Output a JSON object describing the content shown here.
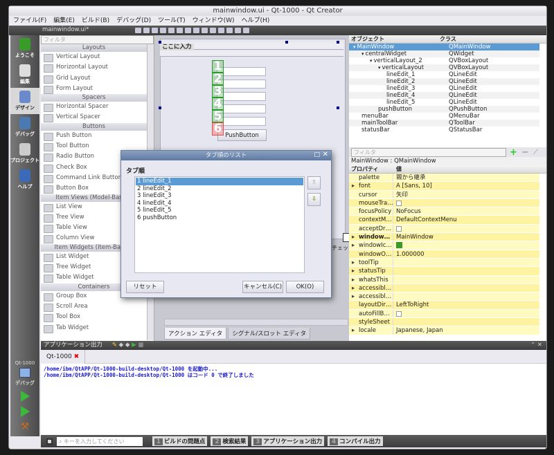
{
  "window": {
    "title": "mainwindow.ui - Qt-1000 - Qt Creator"
  },
  "menu": [
    "ファイル(F)",
    "編集(E)",
    "ビルド(B)",
    "デバッグ(D)",
    "ツール(T)",
    "ウィンドウ(W)",
    "ヘルプ(H)"
  ],
  "toolbar": {
    "file_combo": "mainwindow.ui*"
  },
  "modes": [
    {
      "label": "ようこそ"
    },
    {
      "label": "編集"
    },
    {
      "label": "デザイン",
      "selected": true
    },
    {
      "label": "デバッグ"
    },
    {
      "label": "プロジェクト"
    },
    {
      "label": "ヘルプ"
    }
  ],
  "run_target": {
    "project": "Qt-1000",
    "label": "デバッグ"
  },
  "widget_box": {
    "filter_placeholder": "フィルタ",
    "groups": [
      {
        "name": "Layouts",
        "items": [
          "Vertical Layout",
          "Horizontal Layout",
          "Grid Layout",
          "Form Layout"
        ]
      },
      {
        "name": "Spacers",
        "items": [
          "Horizontal Spacer",
          "Vertical Spacer"
        ]
      },
      {
        "name": "Buttons",
        "items": [
          "Push Button",
          "Tool Button",
          "Radio Button",
          "Check Box",
          "Command Link Button",
          "Button Box"
        ]
      },
      {
        "name": "Item Views (Model-Based)",
        "items": [
          "List View",
          "Tree View",
          "Table View",
          "Column View"
        ]
      },
      {
        "name": "Item Widgets (Item-Based)",
        "items": [
          "List Widget",
          "Tree Widget",
          "Table Widget"
        ]
      },
      {
        "name": "Containers",
        "items": [
          "Group Box",
          "Scroll Area",
          "Tool Box",
          "Tab Widget"
        ]
      }
    ]
  },
  "form": {
    "menu_placeholder": "ここに入力",
    "tab_numbers": [
      "1",
      "2",
      "3",
      "4",
      "5",
      "6"
    ],
    "push_button": "PushButton",
    "partial_tab": "チェッ"
  },
  "bottom_tabs": [
    "アクション エディタ",
    "シグナル/スロット エディタ"
  ],
  "object_inspector": {
    "headers": [
      "オブジェクト",
      "クラス"
    ],
    "rows": [
      {
        "name": "MainWindow",
        "class": "QMainWindow",
        "depth": 0,
        "selected": true,
        "expanded": true
      },
      {
        "name": "centralWidget",
        "class": "QWidget",
        "depth": 1,
        "expanded": true
      },
      {
        "name": "verticalLayout_2",
        "class": "QVBoxLayout",
        "depth": 2,
        "expanded": true
      },
      {
        "name": "verticalLayout",
        "class": "QVBoxLayout",
        "depth": 3,
        "expanded": true
      },
      {
        "name": "lineEdit_1",
        "class": "QLineEdit",
        "depth": 4
      },
      {
        "name": "lineEdit_2",
        "class": "QLineEdit",
        "depth": 4
      },
      {
        "name": "lineEdit_3",
        "class": "QLineEdit",
        "depth": 4
      },
      {
        "name": "lineEdit_4",
        "class": "QLineEdit",
        "depth": 4
      },
      {
        "name": "lineEdit_5",
        "class": "QLineEdit",
        "depth": 4
      },
      {
        "name": "pushButton",
        "class": "QPushButton",
        "depth": 3
      },
      {
        "name": "menuBar",
        "class": "QMenuBar",
        "depth": 1
      },
      {
        "name": "mainToolBar",
        "class": "QToolBar",
        "depth": 1
      },
      {
        "name": "statusBar",
        "class": "QStatusBar",
        "depth": 1
      }
    ]
  },
  "property_editor": {
    "filter_placeholder": "フィルタ",
    "object_label": "MainWindow : QMainWindow",
    "headers": [
      "プロパティ",
      "値"
    ],
    "rows": [
      {
        "name": "palette",
        "value": "親から継承"
      },
      {
        "name": "font",
        "value": "A [Sans, 10]",
        "expandable": true
      },
      {
        "name": "cursor",
        "value": "矢印"
      },
      {
        "name": "mouseTra…",
        "checkbox": true
      },
      {
        "name": "focusPolicy",
        "value": "NoFocus"
      },
      {
        "name": "contextM…",
        "value": "DefaultContextMenu"
      },
      {
        "name": "acceptDr…",
        "checkbox": true
      },
      {
        "name": "window…",
        "value": "MainWindow",
        "expandable": true,
        "bold": true
      },
      {
        "name": "windowIc…",
        "value": "",
        "expandable": true,
        "icon": true
      },
      {
        "name": "windowO…",
        "value": "1.000000"
      },
      {
        "name": "toolTip",
        "value": "",
        "expandable": true
      },
      {
        "name": "statusTip",
        "value": "",
        "expandable": true
      },
      {
        "name": "whatsThis",
        "value": "",
        "expandable": true
      },
      {
        "name": "accessibl…",
        "value": "",
        "expandable": true
      },
      {
        "name": "accessibl…",
        "value": "",
        "expandable": true
      },
      {
        "name": "layoutDir…",
        "value": "LeftToRight"
      },
      {
        "name": "autoFillB…",
        "checkbox": true
      },
      {
        "name": "styleSheet",
        "value": ""
      },
      {
        "name": "locale",
        "value": "Japanese, Japan",
        "expandable": true
      }
    ]
  },
  "output": {
    "title": "アプリケーション出力",
    "tab": "Qt-1000",
    "lines": [
      "/home/ibm/QtAPP/Qt-1000-build-desktop/Qt-1000 を起動中...",
      "/home/ibm/QtAPP/Qt-1000-build-desktop/Qt-1000 はコード 0 で終了しました"
    ]
  },
  "statusbar": {
    "search_placeholder": "キーを入力してください",
    "panes": [
      {
        "n": "1",
        "label": "ビルドの問題点"
      },
      {
        "n": "2",
        "label": "検索結果"
      },
      {
        "n": "3",
        "label": "アプリケーション出力"
      },
      {
        "n": "4",
        "label": "コンパイル出力"
      }
    ]
  },
  "dialog": {
    "title": "タブ順のリスト",
    "label": "タブ順",
    "items": [
      "1 lineEdit_1",
      "2 lineEdit_2",
      "3 lineEdit_3",
      "4 lineEdit_4",
      "5 lineEdit_5",
      "6 pushButton"
    ],
    "selected_index": 0,
    "reset": "リセット",
    "cancel": "キャンセル(C)",
    "ok": "OK(O)"
  },
  "colors": {
    "selection": "#5b9bd5",
    "property_bg": "#fffbc0",
    "output_text": "#1a1acc",
    "tab_green": "#2a9a2a",
    "tab_red": "#e05050"
  }
}
